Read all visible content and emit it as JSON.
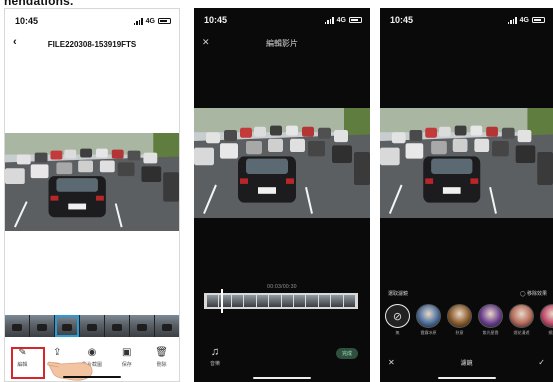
{
  "cropped_caption": "nendations.",
  "panels": [
    {
      "time": "10:45",
      "network": "4G",
      "title": "FILE220308-153919FTS",
      "back_icon": "chevron-left-icon",
      "toolbar": [
        {
          "label": "編輯",
          "icon": "pen-icon"
        },
        {
          "label": "",
          "icon": "share-icon"
        },
        {
          "label": "影片截圖",
          "icon": "camera-icon"
        },
        {
          "label": "保存",
          "icon": "save-icon"
        },
        {
          "label": "刪除",
          "icon": "trash-icon"
        }
      ]
    },
    {
      "time": "10:45",
      "network": "4G",
      "title": "編輯影片",
      "close_icon": "close-icon",
      "timecode": "00:03/00:30",
      "music_label": "音樂",
      "done_label": "完成"
    },
    {
      "time": "10:45",
      "network": "4G",
      "filter_heading": "選取濾鏡",
      "filter_reset": "◯ 移除效果",
      "filters": [
        {
          "label": "無",
          "tone": "none"
        },
        {
          "label": "霞霧冰原",
          "tone": "#4a6e9c"
        },
        {
          "label": "秋意",
          "tone": "#8a5a2a"
        },
        {
          "label": "紫光星雲",
          "tone": "#6a3e8e"
        },
        {
          "label": "煙花漫遊",
          "tone": "#b56a5a"
        },
        {
          "label": "繽紛",
          "tone": "#c24a6a"
        }
      ],
      "bottom_title": "濾鏡"
    }
  ],
  "colors": {
    "highlight_red": "#d6262c",
    "selection_blue": "#2a9bd6",
    "done_green": "#9fe0b8"
  }
}
